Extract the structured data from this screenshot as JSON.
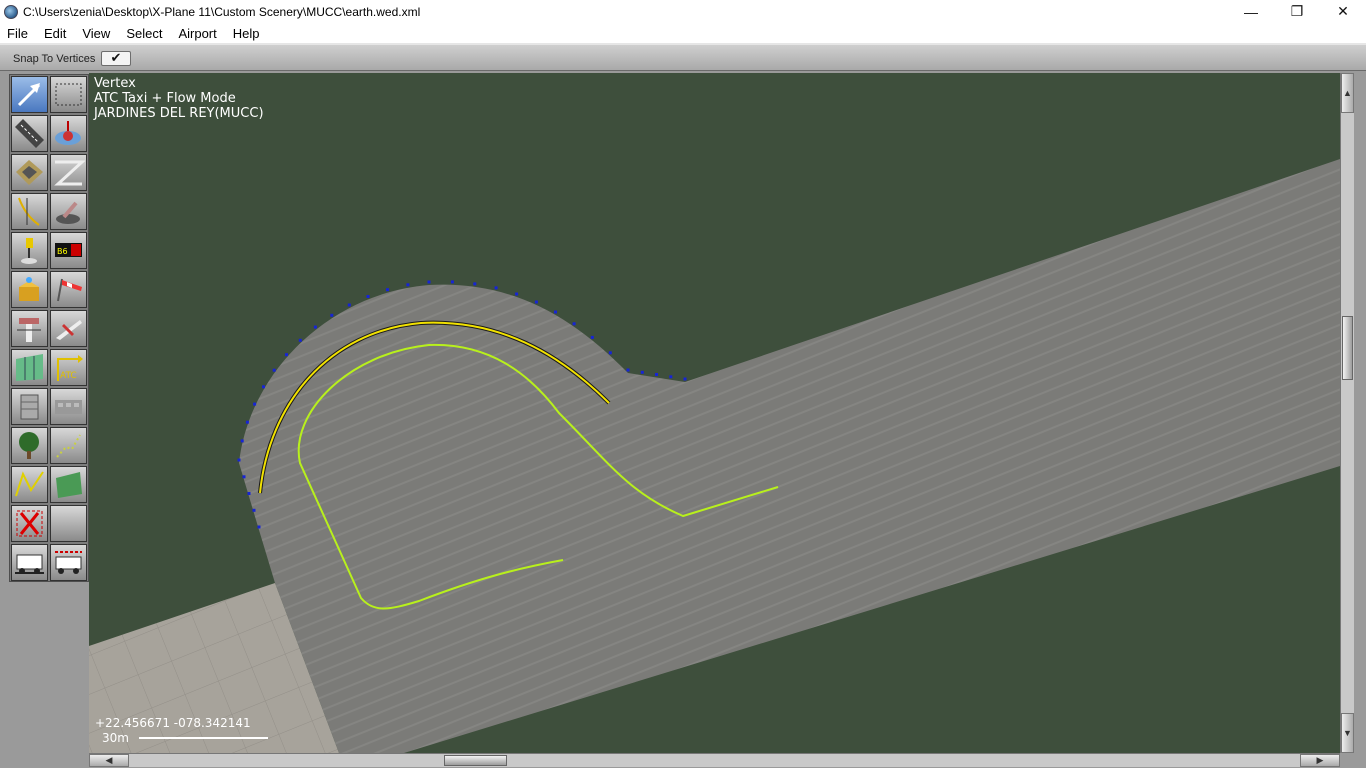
{
  "window": {
    "title": "C:\\Users\\zenia\\Desktop\\X-Plane 11\\Custom Scenery\\MUCC\\earth.wed.xml",
    "minimize_glyph": "—",
    "restore_glyph": "❐",
    "close_glyph": "✕"
  },
  "menu": {
    "items": [
      "File",
      "Edit",
      "View",
      "Select",
      "Airport",
      "Help"
    ]
  },
  "options": {
    "snap_label": "Snap To Vertices",
    "snap_checked": true,
    "snap_glyph": "✔"
  },
  "map": {
    "tool_name": "Vertex",
    "mode": "ATC Taxi + Flow Mode",
    "airport": "JARDINES DEL REY(MUCC)",
    "coordinates": "+22.456671 -078.342141",
    "scale_label": "30m",
    "colors": {
      "grass": "#3e4f3c",
      "asphalt": "#7b7b78",
      "concrete": "#a7a39b",
      "taxi_route": "#b8f01c",
      "selected_route": "#f2e200",
      "vertex_handles": "#1624d6"
    }
  },
  "tools": [
    {
      "id": "vertex",
      "icon": "vertex-arrow-icon",
      "selected": true
    },
    {
      "id": "marquee",
      "icon": "marquee-select-icon",
      "selected": false
    },
    {
      "id": "runway",
      "icon": "runway-icon",
      "selected": false
    },
    {
      "id": "helipad",
      "icon": "helipad-icon",
      "selected": false
    },
    {
      "id": "taxiway",
      "icon": "taxiway-icon",
      "selected": false
    },
    {
      "id": "hole",
      "icon": "hole-icon",
      "selected": false
    },
    {
      "id": "taxilines",
      "icon": "taxilines-icon",
      "selected": false
    },
    {
      "id": "boundary",
      "icon": "boundary-icon",
      "selected": false
    },
    {
      "id": "light",
      "icon": "light-fixture-icon",
      "selected": false
    },
    {
      "id": "sign",
      "icon": "taxi-sign-icon",
      "selected": false
    },
    {
      "id": "beacon",
      "icon": "beacon-icon",
      "selected": false
    },
    {
      "id": "windsock",
      "icon": "windsock-icon",
      "selected": false
    },
    {
      "id": "tower",
      "icon": "tower-viewpoint-icon",
      "selected": false
    },
    {
      "id": "ramp-start",
      "icon": "ramp-start-icon",
      "selected": false
    },
    {
      "id": "facade",
      "icon": "facade-icon",
      "selected": false
    },
    {
      "id": "atc",
      "icon": "atc-route-icon",
      "selected": false
    },
    {
      "id": "object",
      "icon": "object-icon",
      "selected": false
    },
    {
      "id": "object2",
      "icon": "object-building-icon",
      "selected": false
    },
    {
      "id": "forest",
      "icon": "forest-icon",
      "selected": false
    },
    {
      "id": "forest-points",
      "icon": "forest-points-icon",
      "selected": false
    },
    {
      "id": "line",
      "icon": "line-icon",
      "selected": false
    },
    {
      "id": "polygon",
      "icon": "draped-polygon-icon",
      "selected": false
    },
    {
      "id": "exclusion",
      "icon": "exclusion-zone-icon",
      "selected": false
    },
    {
      "id": "blank",
      "icon": "blank-tool-icon",
      "selected": false
    },
    {
      "id": "truck-parking",
      "icon": "truck-parking-icon",
      "selected": false
    },
    {
      "id": "truck-destination",
      "icon": "truck-destination-icon",
      "selected": false
    }
  ]
}
